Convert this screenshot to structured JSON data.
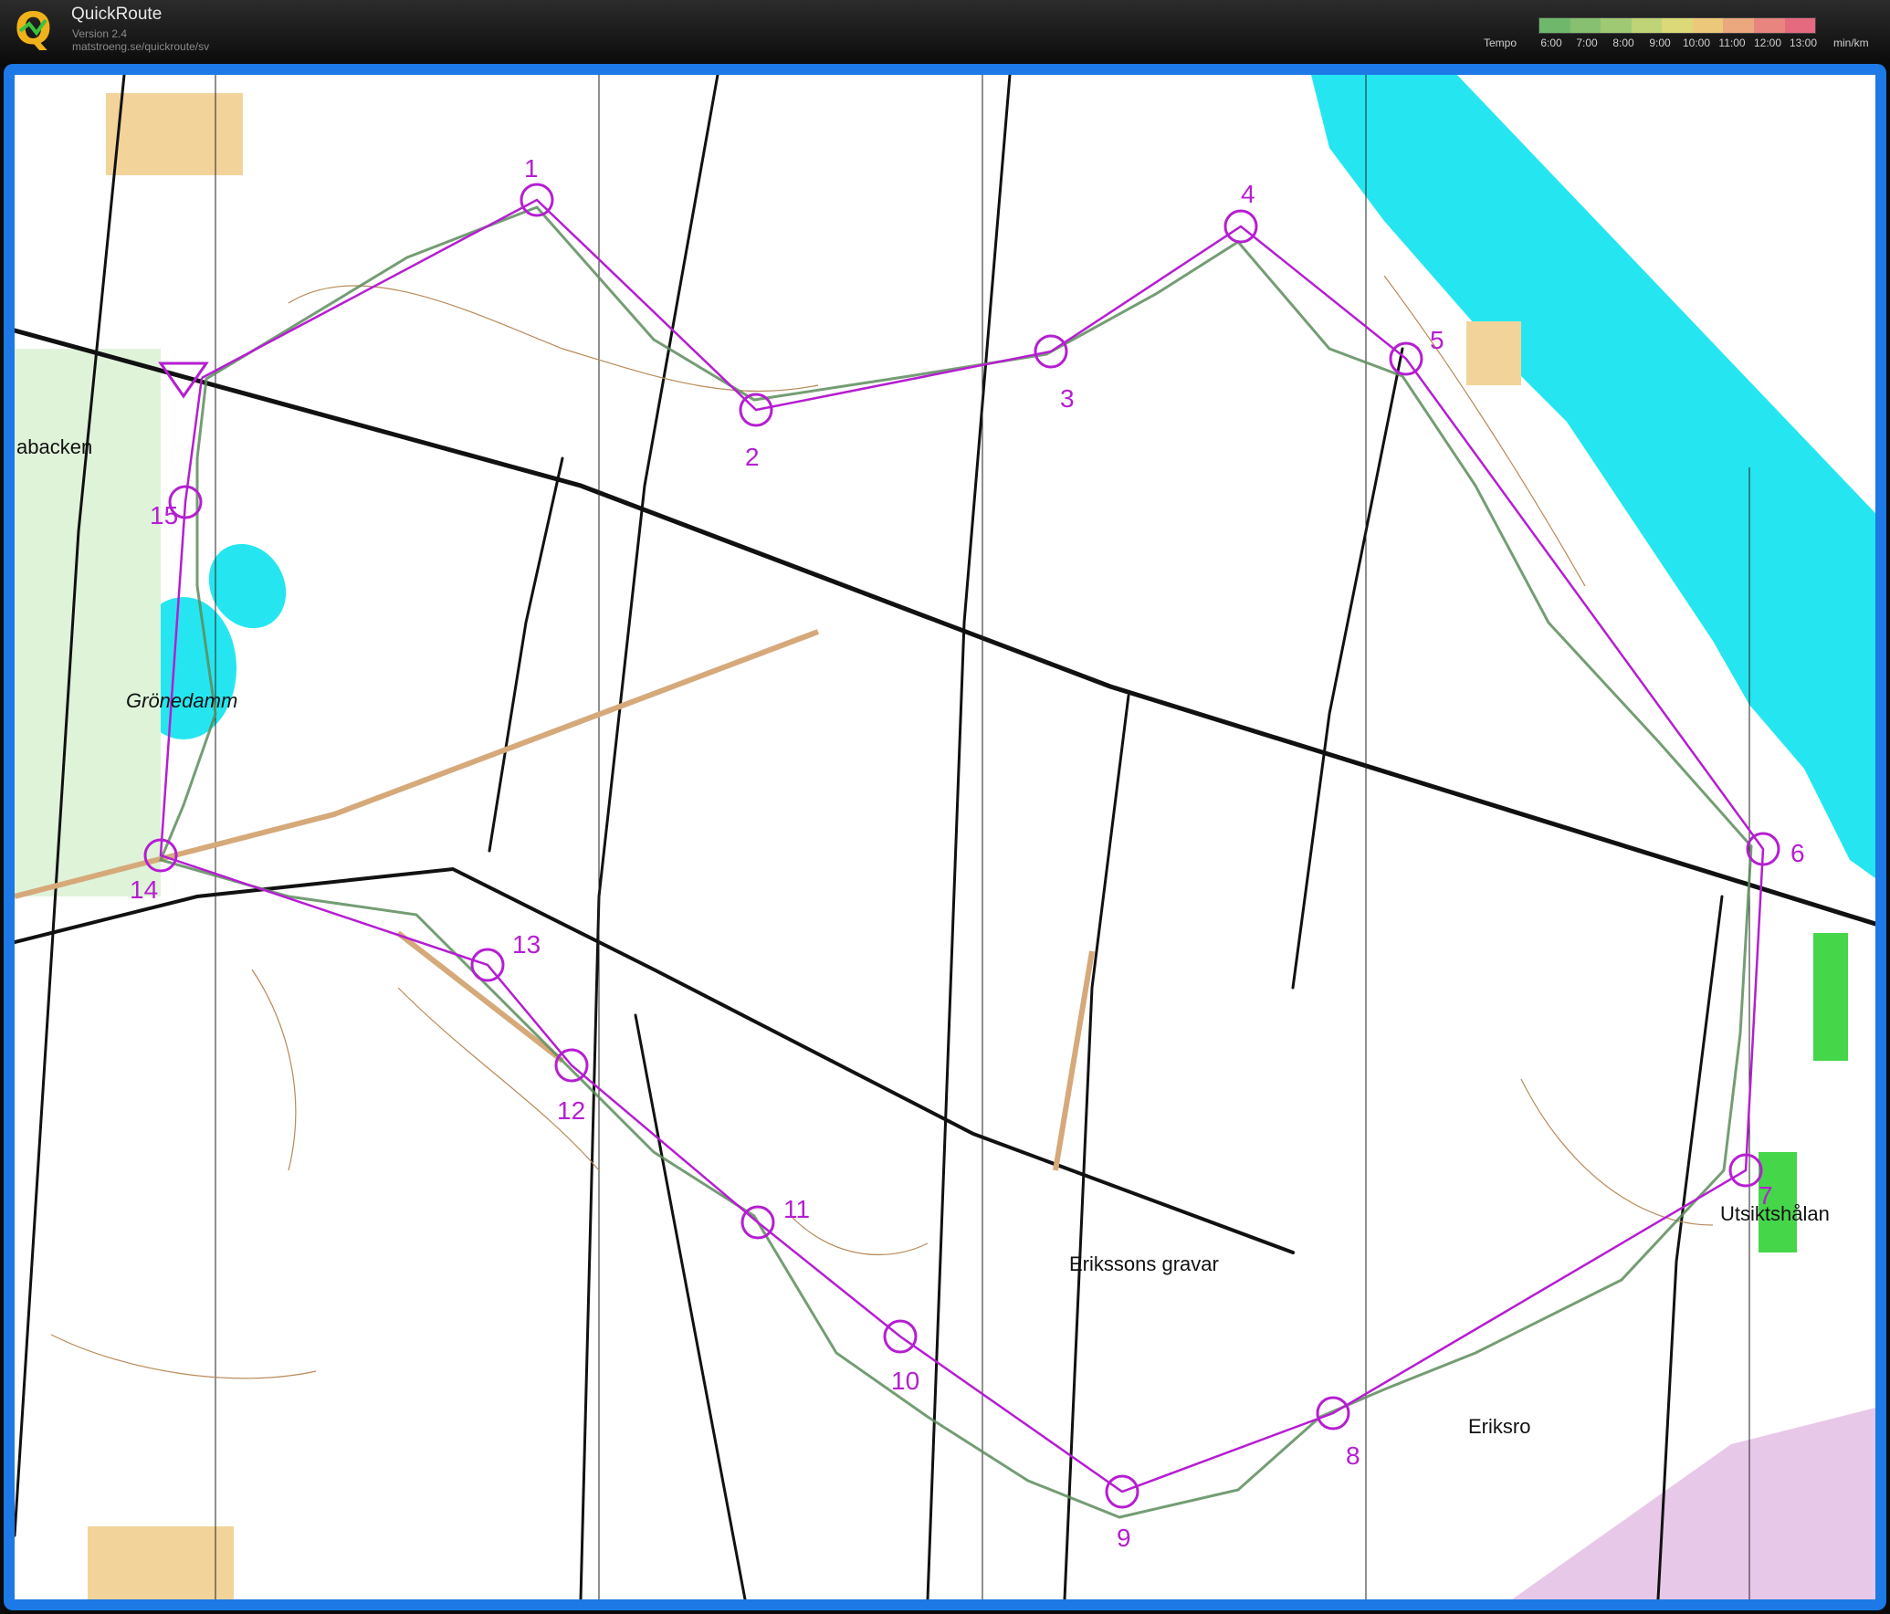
{
  "app": {
    "title": "QuickRoute",
    "version": "Version 2.4",
    "url": "matstroeng.se/quickroute/sv"
  },
  "tempo": {
    "label": "Tempo",
    "ticks": [
      "6:00",
      "7:00",
      "8:00",
      "9:00",
      "10:00",
      "11:00",
      "12:00",
      "13:00"
    ],
    "unit": "min/km",
    "colors": [
      "#6fb86b",
      "#86c070",
      "#a0c974",
      "#bfd377",
      "#dcd978",
      "#ecc97a",
      "#eba77d",
      "#e8857f",
      "#e56a80"
    ]
  },
  "map": {
    "course_color": "#b51ed1",
    "water_color": "#25e6f0",
    "controls": [
      {
        "label": "1"
      },
      {
        "label": "2"
      },
      {
        "label": "3"
      },
      {
        "label": "4"
      },
      {
        "label": "5"
      },
      {
        "label": "6"
      },
      {
        "label": "7"
      },
      {
        "label": "8"
      },
      {
        "label": "9"
      },
      {
        "label": "10"
      },
      {
        "label": "11"
      },
      {
        "label": "12"
      },
      {
        "label": "13"
      },
      {
        "label": "14"
      },
      {
        "label": "15"
      }
    ],
    "place_names": {
      "abacken": "abacken",
      "gronedamm": "Grönedamm",
      "erikssons": "Erikssons gravar",
      "eriksro": "Eriksro",
      "utsikt": "Utsiktshålan"
    }
  }
}
